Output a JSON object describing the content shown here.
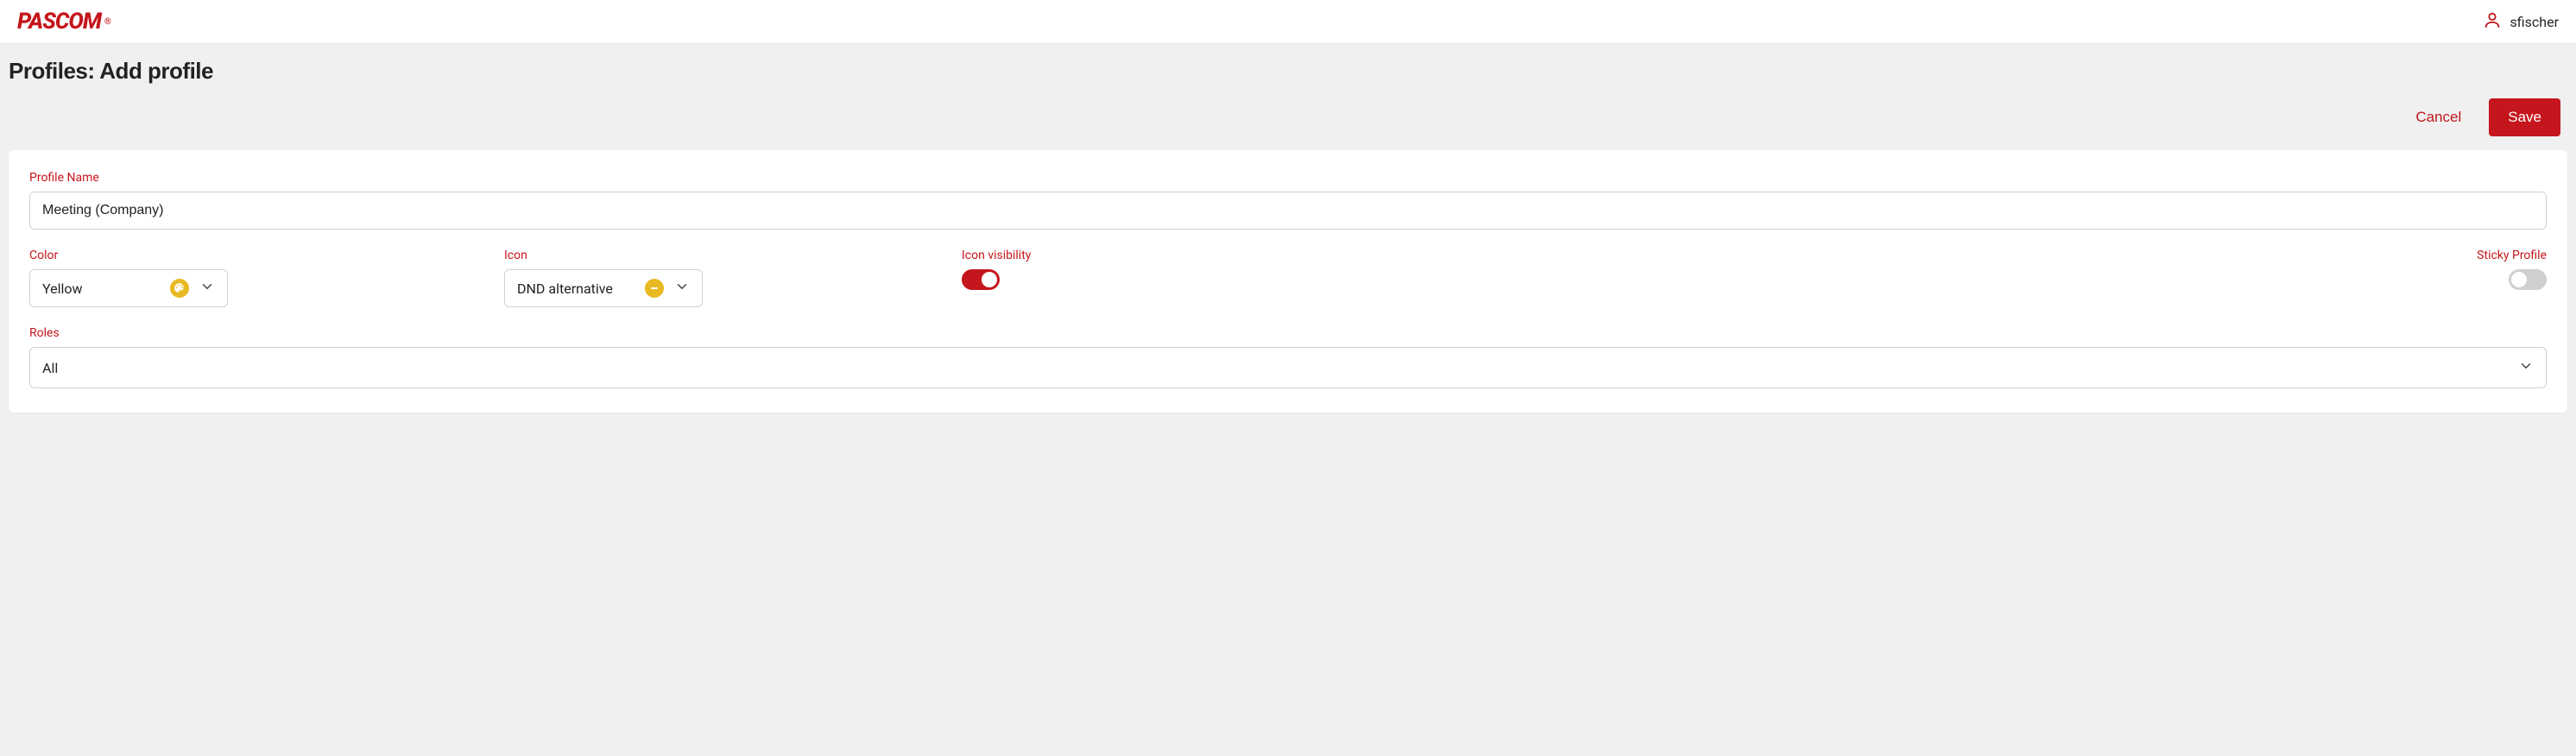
{
  "header": {
    "brand": "PASCOM",
    "registered": "®",
    "username": "sfischer"
  },
  "page": {
    "title": "Profiles: Add profile",
    "cancel_label": "Cancel",
    "save_label": "Save"
  },
  "form": {
    "profile_name_label": "Profile Name",
    "profile_name_value": "Meeting (Company)",
    "color_label": "Color",
    "color_value": "Yellow",
    "icon_label": "Icon",
    "icon_value": "DND alternative",
    "icon_visibility_label": "Icon visibility",
    "icon_visibility_on": true,
    "sticky_label": "Sticky Profile",
    "sticky_on": false,
    "roles_label": "Roles",
    "roles_value": "All"
  },
  "colors": {
    "brand": "#c4161c",
    "swatch_yellow": "#e8b923"
  }
}
